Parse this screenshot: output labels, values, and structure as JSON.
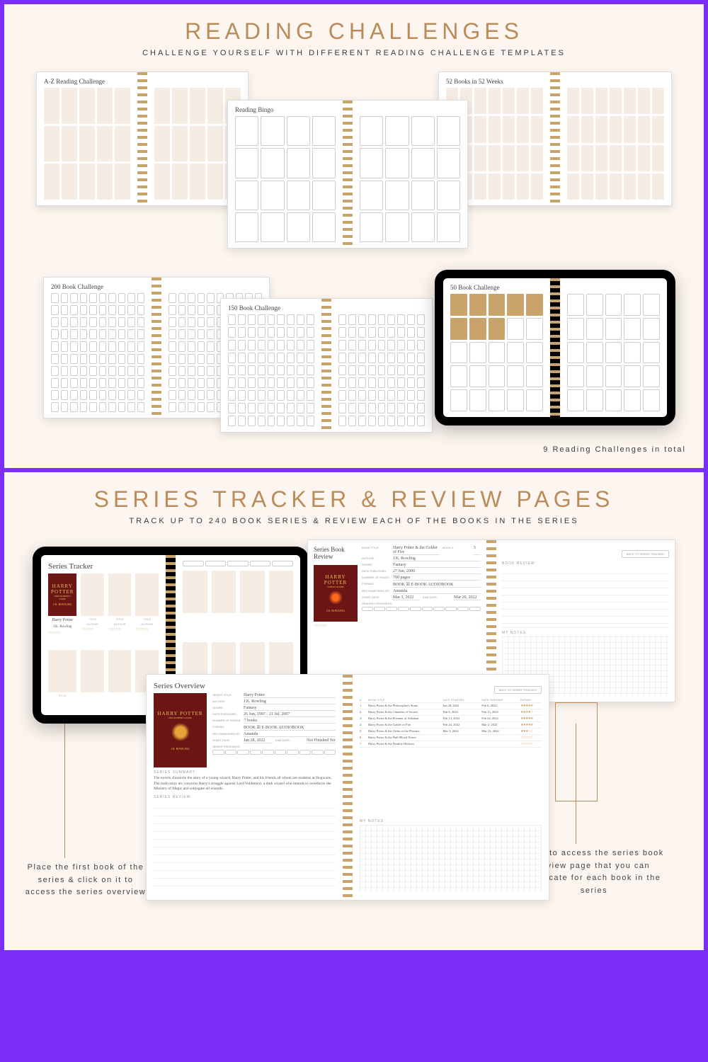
{
  "panel1": {
    "title": "READING CHALLENGES",
    "subtitle": "CHALLENGE YOURSELF WITH DIFFERENT READING CHALLENGE TEMPLATES",
    "footnote": "9 Reading Challenges in total",
    "spreads": {
      "az": "A-Z Reading Challenge",
      "bingo": "Reading Bingo",
      "w52": "52 Books in 52 Weeks",
      "b200": "200 Book Challenge",
      "b150": "150 Book Challenge",
      "b50": "50 Book Challenge"
    }
  },
  "panel2": {
    "title": "SERIES TRACKER & REVIEW PAGES",
    "subtitle": "TRACK UP TO 240 BOOK SERIES & REVIEW EACH OF THE BOOKS IN THE SERIES",
    "callout_left": "Place the first book of the series & click on it to access the series overview",
    "callout_right": "Click to access the series book review page that you can duplicate for each book in the series",
    "tracker": {
      "heading": "Series Tracker",
      "cover_title": "HARRY POTTER",
      "cover_sub": "PHILOSOPHER'S STONE",
      "cover_author": "J.K. ROWLING",
      "label_title": "Harry Potter",
      "label_author": "J.K. Rowling",
      "slot_title": "TITLE",
      "slot_author": "AUTHOR"
    },
    "overview": {
      "heading": "Series Overview",
      "fields": {
        "series_title_lbl": "SERIES TITLE:",
        "series_title_val": "Harry Potter",
        "author_lbl": "AUTHOR:",
        "author_val": "J.K. Rowling",
        "genre_lbl": "GENRE:",
        "genre_val": "Fantasy",
        "date_pub_lbl": "DATE PUBLISHED:",
        "date_pub_val": "26 Jun, 1997 - 21 Jul, 2007",
        "num_books_lbl": "NUMBER OF BOOKS:",
        "num_books_val": "7 books",
        "format_lbl": "FORMAT:",
        "format_val": "BOOK  ☒ E-BOOK   AUDIOBOOK",
        "rec_lbl": "RECOMMENDED BY:",
        "rec_val": "Amanda",
        "start_lbl": "START DATE:",
        "start_val": "Jan 28, 2022",
        "end_lbl": "END DATE:",
        "end_val": "Not Finished Yet",
        "progress_lbl": "SERIES PROGRESS:"
      },
      "summary_lbl": "SERIES SUMMARY:",
      "summary_text": "The novels chronicle the story of a young wizard, Harry Potter, and his friends all whom are students at Hogwarts. The main story arc concerns Harry's struggle against Lord Voldemort, a dark wizard who intends to overthrow the Ministry of Magic and subjugate all wizards.",
      "review_lbl": "SERIES REVIEW:",
      "table_hdr": {
        "n": "#",
        "title": "BOOK TITLE",
        "start": "DATE STARTED",
        "end": "DATE FINISHED",
        "rating": "RATING"
      },
      "books": [
        {
          "n": "1",
          "title": "Harry Potter & the Philosopher's Stone",
          "start": "Jan 28, 2022",
          "end": "Feb 6, 2022",
          "stars": "★★★★★"
        },
        {
          "n": "2",
          "title": "Harry Potter & the Chamber of Secrets",
          "start": "Feb 8, 2022",
          "end": "Feb 13, 2022",
          "stars": "★★★★☆"
        },
        {
          "n": "3",
          "title": "Harry Potter & the Prisoner of Azkaban",
          "start": "Feb 14, 2022",
          "end": "Feb 24, 2022",
          "stars": "★★★★★"
        },
        {
          "n": "4",
          "title": "Harry Potter & the Goblet of Fire",
          "start": "Feb 24, 2022",
          "end": "Mar 2, 2022",
          "stars": "★★★★★"
        },
        {
          "n": "5",
          "title": "Harry Potter & the Order of the Phoenix",
          "start": "Mar 3, 2022",
          "end": "Mar 23, 2022",
          "stars": "★★★☆☆"
        },
        {
          "n": "6",
          "title": "Harry Potter & the Half-Blood Prince",
          "start": "",
          "end": "",
          "stars": "☆☆☆☆☆"
        },
        {
          "n": "7",
          "title": "Harry Potter & the Deathly Hallows",
          "start": "",
          "end": "",
          "stars": "☆☆☆☆☆"
        }
      ],
      "notes_lbl": "MY NOTES",
      "back_btn": "BACK TO SERIES TRACKER"
    },
    "review": {
      "heading": "Series Book Review",
      "cover_title": "HARRY POTTER",
      "cover_sub": "GOBLET OF FIRE",
      "cover_author": "J.K. ROWLING",
      "fields": {
        "title_lbl": "BOOK TITLE:",
        "title_val": "Harry Potter & the Goblet of Fire",
        "bookn_lbl": "BOOK #:",
        "bookn_val": "5",
        "author_lbl": "AUTHOR:",
        "author_val": "J.K. Rowling",
        "genre_lbl": "GENRE:",
        "genre_val": "Fantasy",
        "date_pub_lbl": "DATE PUBLISHED:",
        "date_pub_val": "27 Jun, 2000",
        "pages_lbl": "NUMBER OF PAGES:",
        "pages_val": "700 pages",
        "format_lbl": "FORMAT:",
        "format_val": "BOOK  ☒ E-BOOK   AUDIOBOOK",
        "rec_lbl": "RECOMMENDED BY:",
        "rec_val": "Amanda",
        "start_lbl": "START DATE:",
        "start_val": "Mar 3, 2022",
        "end_lbl": "END DATE:",
        "end_val": "Mar 20, 2022",
        "progress_lbl": "READING PROGRESS:"
      },
      "book_review_lbl": "BOOK REVIEW:",
      "notes_lbl": "MY NOTES",
      "back_btn": "BACK TO SERIES TRACKER"
    }
  }
}
